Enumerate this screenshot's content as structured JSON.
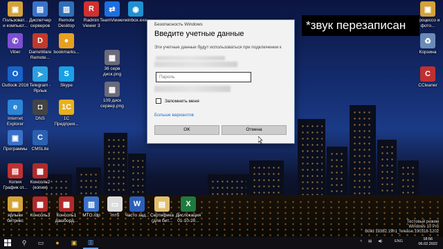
{
  "desktop": {
    "icons": [
      {
        "label": "Пользоват... и компьют...",
        "icon": "users-folder-icon",
        "color": "#d4a23a",
        "glyph": "▣"
      },
      {
        "label": "Диспетчер серверов",
        "icon": "server-manager-icon",
        "color": "#3a72c8",
        "glyph": "▤"
      },
      {
        "label": "Remote Desktop",
        "icon": "remote-desktop-icon",
        "color": "#2f6fb8",
        "glyph": "▥"
      },
      {
        "label": "Radmin Viewer 3",
        "icon": "radmin-icon",
        "color": "#d03030",
        "glyph": "R"
      },
      {
        "label": "TeamViewer",
        "icon": "teamviewer-icon",
        "color": "#1d6fe0",
        "glyph": "⇄"
      },
      {
        "label": "winbox.exe",
        "icon": "winbox-icon",
        "color": "#2090d0",
        "glyph": "◉"
      },
      {
        "label": "Viber",
        "icon": "viber-icon",
        "color": "#7d4fd0",
        "glyph": "✆"
      },
      {
        "label": "DameWare Remote...",
        "icon": "dameware-icon",
        "color": "#c03a2a",
        "glyph": "D"
      },
      {
        "label": "bookmarks...",
        "icon": "chrome-icon",
        "color": "#e8a020",
        "glyph": "●"
      },
      {
        "label": "36 серв диск.png",
        "icon": "image-file-icon",
        "color": "#6a6a7a",
        "glyph": "▦"
      },
      {
        "label": "Outlook 2016",
        "icon": "outlook-icon",
        "color": "#1763c8",
        "glyph": "O"
      },
      {
        "label": "Telegram - Ярлык",
        "icon": "telegram-icon",
        "color": "#2aa0e0",
        "glyph": "➤"
      },
      {
        "label": "Skype",
        "icon": "skype-icon",
        "color": "#1aa0e6",
        "glyph": "S"
      },
      {
        "label": "109 диск сервер.png",
        "icon": "image-file-icon",
        "color": "#6a6a7a",
        "glyph": "▦"
      },
      {
        "label": "Internet Explorer",
        "icon": "internet-explorer-icon",
        "color": "#2a86d8",
        "glyph": "e"
      },
      {
        "label": "DNS",
        "icon": "dns-icon",
        "color": "#444",
        "glyph": "◘"
      },
      {
        "label": "1С Предприя...",
        "icon": "1c-icon",
        "color": "#e8b020",
        "glyph": "1С"
      },
      {
        "label": "Программы",
        "icon": "programs-folder-icon",
        "color": "#3a72c8",
        "glyph": "▣"
      },
      {
        "label": "CMSLite",
        "icon": "cmslite-icon",
        "color": "#2a60b0",
        "glyph": "C"
      },
      {
        "label": "Копия График от...",
        "icon": "excel-file-icon",
        "color": "#c03030",
        "glyph": "▤"
      },
      {
        "label": "Консоль2 (копия)",
        "icon": "toolbox-icon",
        "color": "#b02a2a",
        "glyph": "▩"
      },
      {
        "label": "ярлыки битрикс",
        "icon": "shortcut-folder-icon",
        "color": "#d4a23a",
        "glyph": "▣"
      },
      {
        "label": "Консоль3",
        "icon": "toolbox-icon",
        "color": "#b02a2a",
        "glyph": "▩"
      },
      {
        "label": "Консоль1 дашборд...",
        "icon": "toolbox-icon",
        "color": "#b02a2a",
        "glyph": "▩"
      },
      {
        "label": "MTO.rdp",
        "icon": "rdp-icon",
        "color": "#3a72c8",
        "glyph": "▥"
      },
      {
        "label": "mтб",
        "icon": "document-icon",
        "color": "#dcdcdc",
        "glyph": "▭"
      },
      {
        "label": "Часто зад...",
        "icon": "word-file-icon",
        "color": "#2b5fb8",
        "glyph": "W"
      },
      {
        "label": "Сертифика (для бит...",
        "icon": "certificate-file-icon",
        "color": "#e0c070",
        "glyph": "▤"
      },
      {
        "label": "Дислокация 01-10-20...",
        "icon": "excel-file-icon",
        "color": "#1f7a3f",
        "glyph": "X"
      },
      {
        "label": "Корзина",
        "icon": "recycle-bin-icon",
        "color": "#6a8ab8",
        "glyph": "♻"
      },
      {
        "label": "Процессо и фото...",
        "icon": "folder-icon",
        "color": "#d4a23a",
        "glyph": "▣"
      },
      {
        "label": "CCleaner",
        "icon": "ccleaner-icon",
        "color": "#c03030",
        "glyph": "C"
      }
    ]
  },
  "caption": "*звук перезаписан",
  "dialog": {
    "window_title": "Безопасность Windows",
    "heading": "Введите учетные данные",
    "description": "Эти учетные данные будут использоваться при подключении к",
    "password_placeholder": "Пароль",
    "remember_label": "Запомнить меня",
    "more_options": "Больше вариантов",
    "ok_label": "OK",
    "cancel_label": "Отмена"
  },
  "watermark": {
    "line1": "Тестовый режим",
    "line2": "Windows 10 Pro",
    "line3": "Build 18362.19h1_release.190318-1202"
  },
  "taskbar": {
    "language": "ENG",
    "time": "18:56",
    "date": "06.02.2022"
  }
}
